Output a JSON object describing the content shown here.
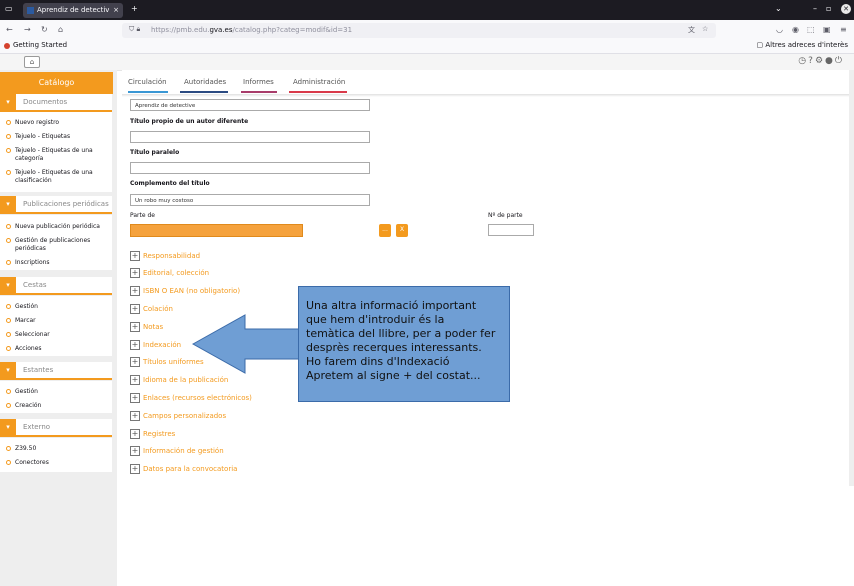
{
  "browser": {
    "tab_title": "Aprendiz de detective",
    "tab_close": "×",
    "new_tab": "+",
    "url_prefix": "https://pmb.edu.",
    "url_domain": "gva.es",
    "url_suffix": "/catalog.php?categ=modif&id=31",
    "bookmark_left": "Getting Started",
    "bookmark_right": "Altres adreces d'interès"
  },
  "sidebar": {
    "catalog_title": "Catálogo",
    "sections": [
      {
        "title": "Documentos",
        "items": [
          "Nuevo registro",
          "Tejuelo - Etiquetas",
          "Tejuelo - Etiquetas de una categoría",
          "Tejuelo - Etiquetas de una clasificación"
        ]
      },
      {
        "title": "Publicaciones periódicas",
        "items": [
          "Nueva publicación periódica",
          "Gestión de publicaciones periódicas",
          "Inscriptions"
        ]
      },
      {
        "title": "Cestas",
        "items": [
          "Gestión",
          "Marcar",
          "Seleccionar",
          "Acciones"
        ]
      },
      {
        "title": "Estantes",
        "items": [
          "Gestión",
          "Creación"
        ]
      },
      {
        "title": "Externo",
        "items": [
          "Z39.50",
          "Conectores"
        ]
      }
    ]
  },
  "main_tabs": [
    "Circulación",
    "Autoridades",
    "Informes",
    "Administración"
  ],
  "form": {
    "title_value": "Aprendiz de detective",
    "label_other_author_title": "Título propio de un autor diferente",
    "label_parallel_title": "Título paralelo",
    "label_title_complement": "Complemento del título",
    "complement_value": "Un robo muy costoso",
    "label_part_of": "Parte de",
    "label_part_number": "Nº de parte",
    "btn_ellipsis": "...",
    "btn_x": "X"
  },
  "sections": [
    "Responsabilidad",
    "Editorial, colección",
    "ISBN O EAN (no obligatorio)",
    "Colación",
    "Notas",
    "Indexación",
    "Títulos uniformes",
    "Idioma de la publicación",
    "Enlaces (recursos electrónicos)",
    "Campos personalizados",
    "Registres",
    "Información de gestión",
    "Datos para la convocatoria"
  ],
  "annotation": {
    "lines": [
      "Una altra informació important",
      "que hem d'introduir és la",
      "temàtica del llibre, per a poder fer",
      "desprès recerques interessants.",
      "Ho farem dins d'Indexació",
      "Apretem al signe + del costat..."
    ]
  },
  "colors": {
    "accent": "#f39a1e",
    "annotation_fill": "#6f9ed4"
  }
}
